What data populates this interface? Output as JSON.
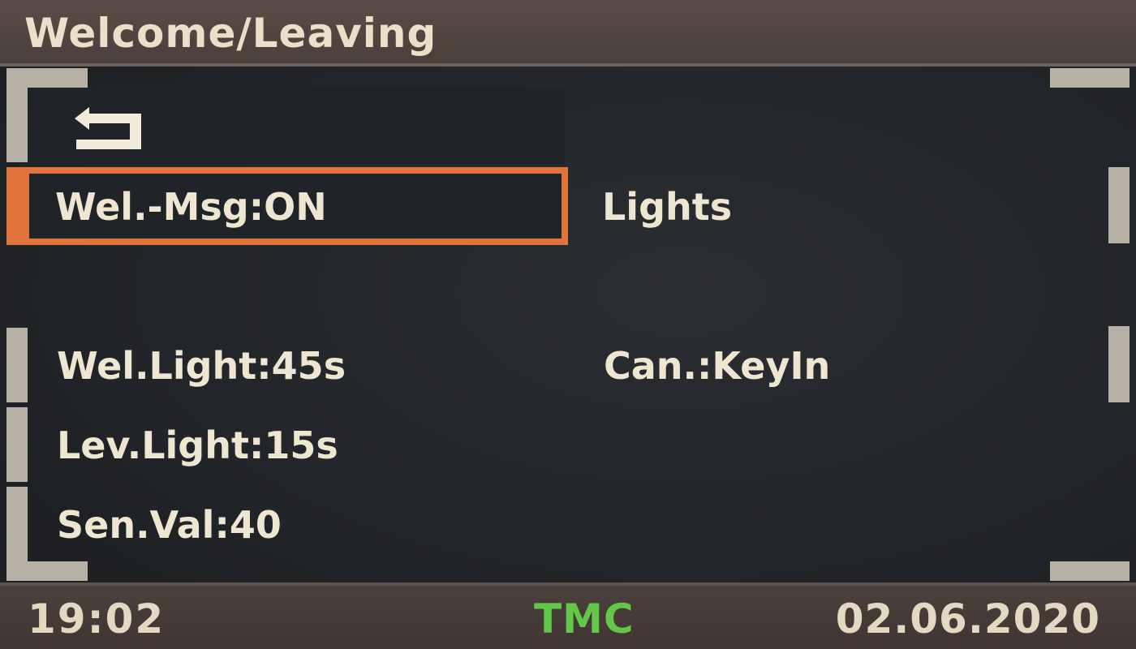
{
  "header": {
    "title": "Welcome/Leaving"
  },
  "back": {
    "icon": "back-arrow-icon"
  },
  "menu": {
    "items": [
      {
        "label": "Wel.-Msg:ON",
        "selected": true
      },
      {
        "label": "Lights",
        "selected": false
      },
      {
        "label": "Wel.Light:45s",
        "selected": false
      },
      {
        "label": "Can.:KeyIn",
        "selected": false
      },
      {
        "label": "Lev.Light:15s",
        "selected": false
      },
      {
        "label": "Sen.Val:40",
        "selected": false
      }
    ]
  },
  "status": {
    "time": "19:02",
    "tmc": "TMC",
    "date": "02.06.2020"
  },
  "colors": {
    "selection_border": "#e0743a",
    "tmc_green": "#63c84a",
    "text": "#efe6d2"
  }
}
